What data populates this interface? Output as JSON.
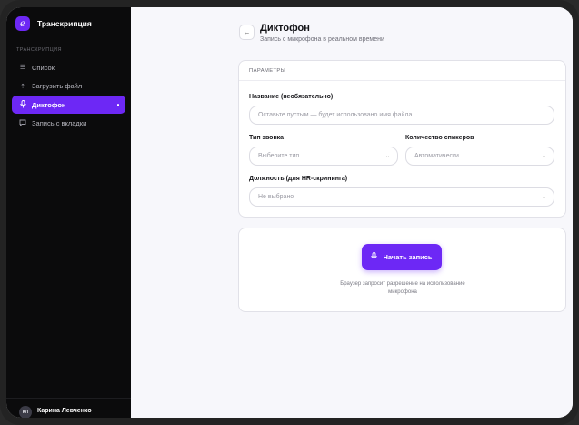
{
  "app": {
    "brand_name": "Транскрипция",
    "brand_logo_letter": "e"
  },
  "sidebar": {
    "section_label": "ТРАНСКРИПЦИЯ",
    "items": [
      {
        "label": "Список",
        "icon": "list-icon"
      },
      {
        "label": "Загрузить файл",
        "icon": "upload-icon"
      },
      {
        "label": "Диктофон",
        "icon": "mic-icon",
        "active": true
      },
      {
        "label": "Запись с вкладки",
        "icon": "chat-icon"
      }
    ]
  },
  "user": {
    "initials": "КЛ",
    "name": "Карина Левченко"
  },
  "page": {
    "title": "Диктофон",
    "subtitle": "Запись с микрофона в реальном времени"
  },
  "params": {
    "header": "ПАРАМЕТРЫ",
    "name_label": "Название (необязательно)",
    "name_placeholder": "Оставьте пустым — будет использовано имя файла",
    "call_type_label": "Тип звонка",
    "call_type_value": "Выберите тип...",
    "speakers_label": "Количество спикеров",
    "speakers_value": "Автоматически",
    "position_label": "Должность (для HR-скрининга)",
    "position_value": "Не выбрано"
  },
  "record": {
    "button_label": "Начать запись",
    "note": "Браузер запросит разрешение на использование микрофона"
  },
  "colors": {
    "accent": "#6d28f5",
    "sidebar_bg": "#0b0b0c",
    "main_bg": "#f7f7fb"
  }
}
